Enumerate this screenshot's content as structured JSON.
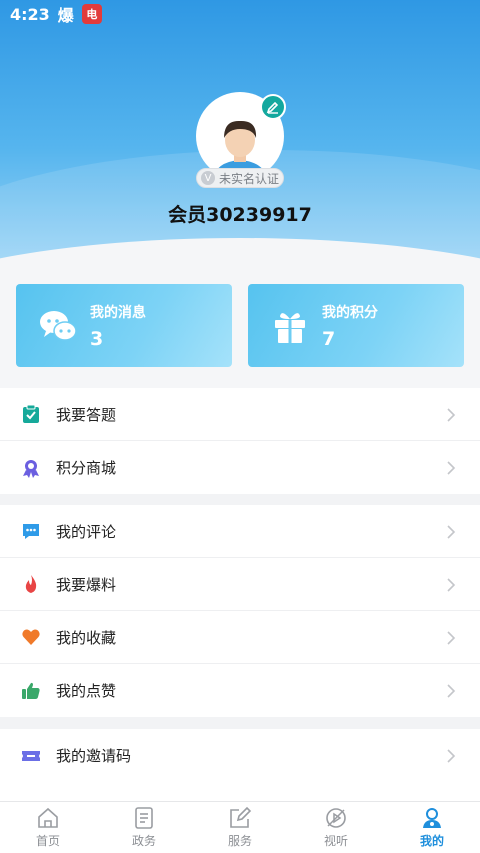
{
  "status_bar": {
    "time": "4:23",
    "carrier_icon_text": "爆",
    "app_badge": "电"
  },
  "profile": {
    "verify_label": "未实名认证",
    "username": "会员30239917"
  },
  "cards": [
    {
      "title": "我的消息",
      "count": "3",
      "icon": "chat-bubbles-icon"
    },
    {
      "title": "我的积分",
      "count": "7",
      "icon": "gift-icon"
    }
  ],
  "menu_groups": [
    [
      {
        "label": "我要答题",
        "icon": "clipboard-check-icon",
        "color": "#16a99a"
      },
      {
        "label": "积分商城",
        "icon": "medal-icon",
        "color": "#6b5fe0"
      }
    ],
    [
      {
        "label": "我的评论",
        "icon": "comment-icon",
        "color": "#2f9be8"
      },
      {
        "label": "我要爆料",
        "icon": "flame-icon",
        "color": "#e84545"
      },
      {
        "label": "我的收藏",
        "icon": "heart-icon",
        "color": "#f07a2a"
      },
      {
        "label": "我的点赞",
        "icon": "thumbs-up-icon",
        "color": "#3aa86a"
      }
    ],
    [
      {
        "label": "我的邀请码",
        "icon": "ticket-icon",
        "color": "#6b6fe6"
      }
    ]
  ],
  "tabs": [
    {
      "label": "首页",
      "icon": "home-icon",
      "active": false
    },
    {
      "label": "政务",
      "icon": "document-icon",
      "active": false
    },
    {
      "label": "服务",
      "icon": "edit-square-icon",
      "active": false
    },
    {
      "label": "视听",
      "icon": "video-icon",
      "active": false
    },
    {
      "label": "我的",
      "icon": "user-icon",
      "active": true
    }
  ],
  "colors": {
    "accent": "#1f8fdc",
    "header_top": "#2f98e4",
    "card": "#6ecdf3"
  }
}
